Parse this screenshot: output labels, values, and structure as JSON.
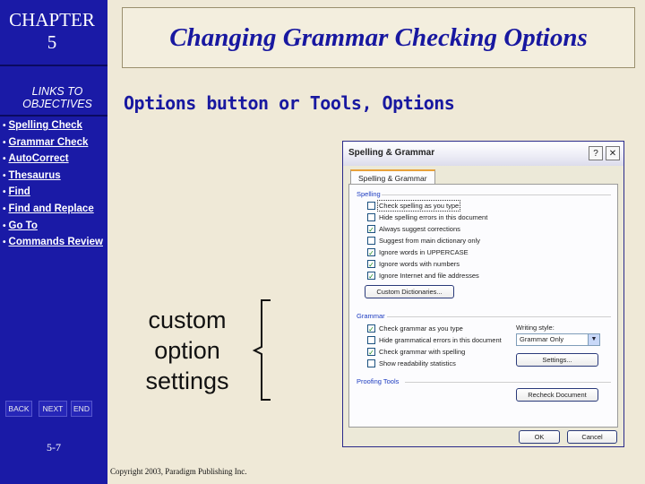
{
  "sidebar": {
    "chapter_line1": "CHAPTER",
    "chapter_line2": "5",
    "links_line1": "LINKS TO",
    "links_line2": "OBJECTIVES",
    "objectives": [
      "Spelling Check",
      "Grammar Check",
      "AutoCorrect",
      "Thesaurus",
      "Find",
      "Find and Replace",
      "Go To",
      "Commands Review"
    ],
    "nav": {
      "back": "BACK",
      "next": "NEXT",
      "end": "END"
    },
    "page_number": "5-7"
  },
  "slide": {
    "title": "Changing Grammar Checking Options",
    "subtitle": "Options button or Tools, Options",
    "annotation_line1": "custom",
    "annotation_line2": "option",
    "annotation_line3": "settings",
    "copyright": "Copyright 2003, Paradigm Publishing Inc."
  },
  "dialog": {
    "title": "Spelling & Grammar",
    "help": "?",
    "close": "✕",
    "tab": "Spelling & Grammar",
    "spelling_group": "Spelling",
    "spelling_options": [
      {
        "label": "Check spelling as you type",
        "checked": false
      },
      {
        "label": "Hide spelling errors in this document",
        "checked": false
      },
      {
        "label": "Always suggest corrections",
        "checked": true
      },
      {
        "label": "Suggest from main dictionary only",
        "checked": false
      },
      {
        "label": "Ignore words in UPPERCASE",
        "checked": true
      },
      {
        "label": "Ignore words with numbers",
        "checked": true
      },
      {
        "label": "Ignore Internet and file addresses",
        "checked": true
      }
    ],
    "custom_dictionaries": "Custom Dictionaries...",
    "grammar_group": "Grammar",
    "grammar_options": [
      {
        "label": "Check grammar as you type",
        "checked": true
      },
      {
        "label": "Hide grammatical errors in this document",
        "checked": false
      },
      {
        "label": "Check grammar with spelling",
        "checked": true
      },
      {
        "label": "Show readability statistics",
        "checked": false
      }
    ],
    "writing_style_label": "Writing style:",
    "writing_style_value": "Grammar Only",
    "settings_button": "Settings...",
    "proofing_group": "Proofing Tools",
    "recheck_button": "Recheck Document",
    "ok_button": "OK",
    "cancel_button": "Cancel"
  },
  "colors": {
    "sidebar": "#1a1aa6",
    "title_text": "#1818a0",
    "background": "#efe9d7",
    "group_label": "#1c3bc0"
  }
}
